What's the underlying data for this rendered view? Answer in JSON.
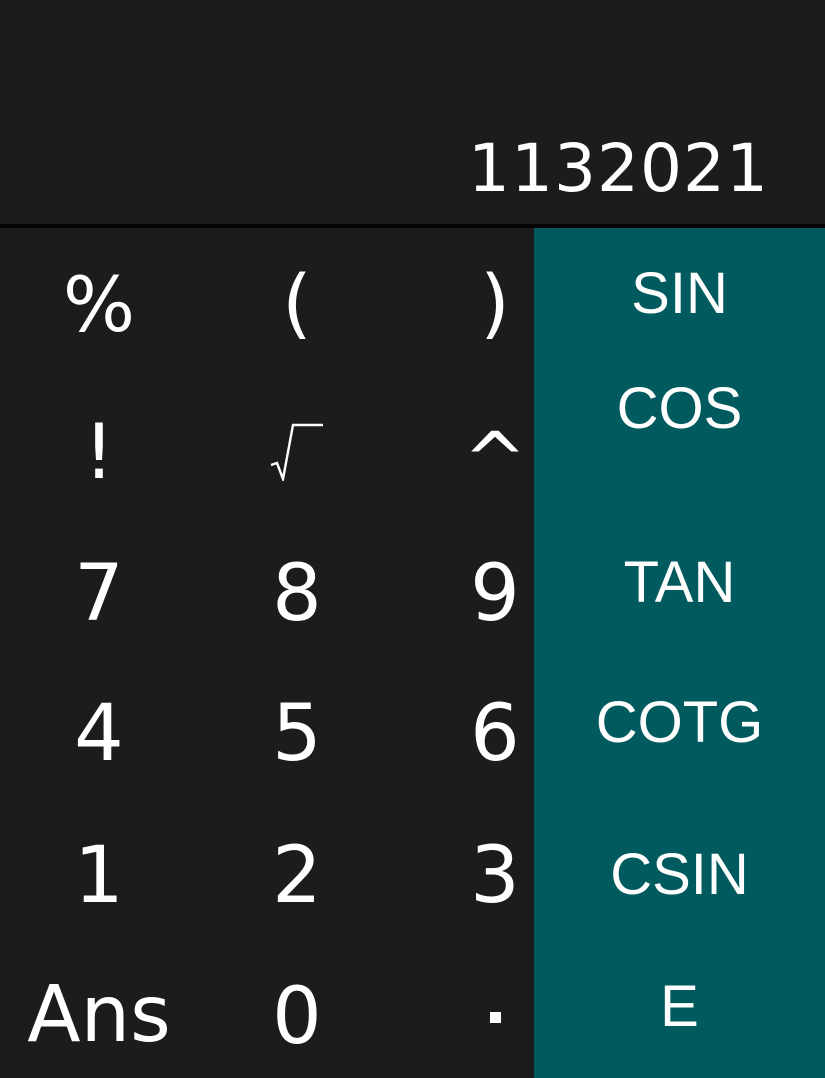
{
  "display": {
    "value": "1132021"
  },
  "keypad": {
    "rows": [
      [
        "%",
        "(",
        ")"
      ],
      [
        "!",
        "√",
        "^"
      ],
      [
        "7",
        "8",
        "9"
      ],
      [
        "4",
        "5",
        "6"
      ],
      [
        "1",
        "2",
        "3"
      ],
      [
        "Ans",
        "0",
        "."
      ]
    ]
  },
  "scientific": {
    "keys": [
      "SIN",
      "COS",
      "TAN",
      "COTG",
      "CSIN",
      "E"
    ]
  },
  "colors": {
    "background": "#1c1c1c",
    "panel": "#005a5e",
    "text": "#ffffff"
  }
}
